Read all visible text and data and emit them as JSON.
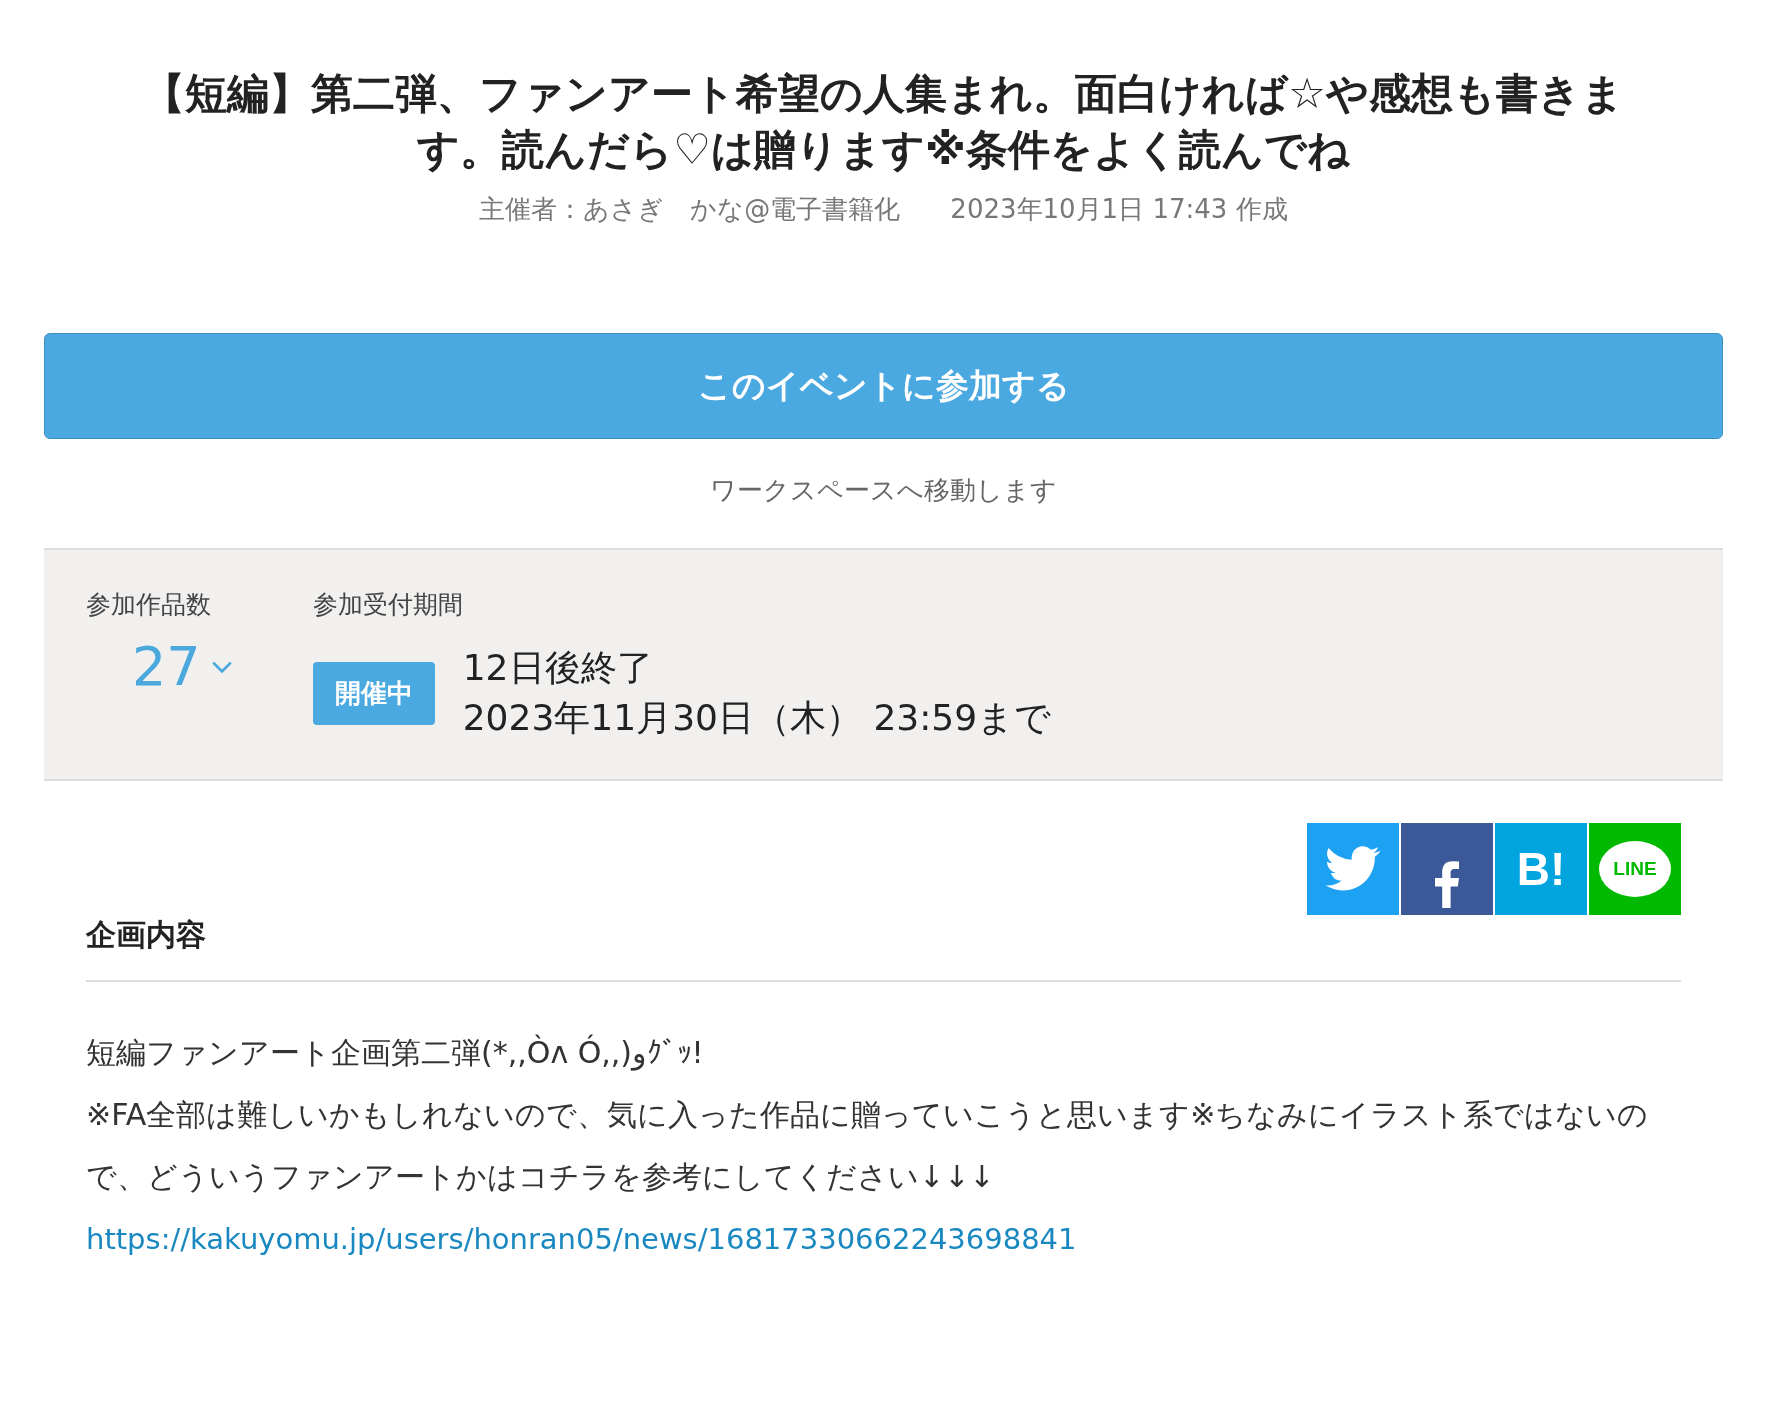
{
  "event": {
    "title": "【短編】第二弾、ファンアート希望の人集まれ。面白ければ☆や感想も書きます。読んだら♡は贈ります※条件をよく読んでね",
    "organizer": "主催者：あさぎ　かな@電子書籍化",
    "created": "2023年10月1日 17:43 作成"
  },
  "join_button": {
    "label": "このイベントに参加する",
    "note": "ワークスペースへ移動します"
  },
  "info": {
    "entries_label": "参加作品数",
    "entries_count": "27",
    "entries_expanded": false,
    "period_label": "参加受付期間",
    "status_badge": "開催中",
    "remaining": "12日後終了",
    "deadline": "2023年11月30日（木） 23:59まで"
  },
  "share_buttons": [
    {
      "kind": "twitter",
      "color": "#1da1f2"
    },
    {
      "kind": "facebook",
      "color": "#3b5998"
    },
    {
      "kind": "hatena",
      "color": "#00a4de",
      "label": "B!"
    },
    {
      "kind": "line",
      "color": "#00b900",
      "label": "LINE"
    }
  ],
  "section": {
    "heading": "企画内容",
    "paragraphs": [
      "短編ファンアート企画第二弾(*,,Òᴧ Ó,,)وｸﾞｯ!",
      "※FA全部は難しいかもしれないので、気に入った作品に贈っていこうと思います※ちなみにイラスト系ではないので、どういうファンアートかはコチラを参考にしてください↓↓↓"
    ],
    "link": "https://kakuyomu.jp/users/honran05/news/16817330662243698841"
  }
}
